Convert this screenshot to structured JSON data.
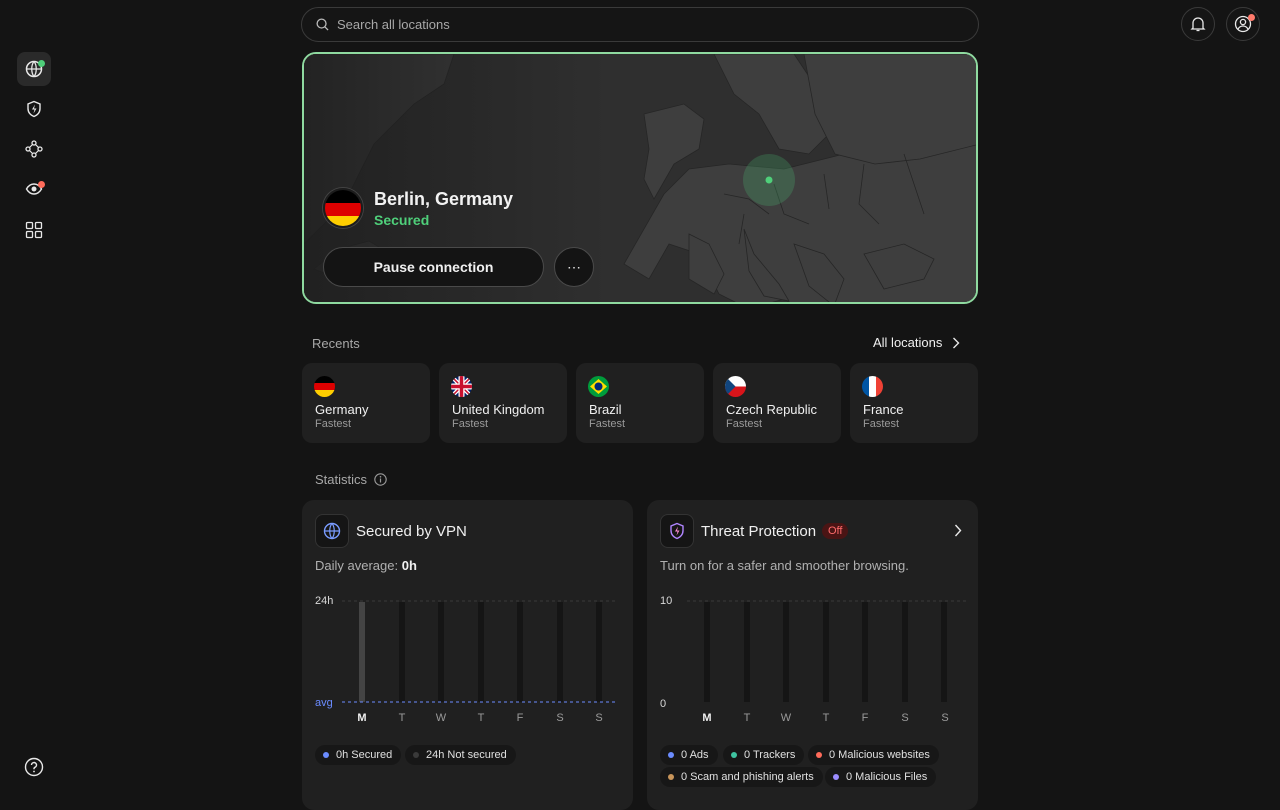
{
  "search": {
    "placeholder": "Search all locations"
  },
  "connection": {
    "location": "Berlin, Germany",
    "status": "Secured",
    "pause_label": "Pause connection",
    "more_label": "⋯"
  },
  "recents": {
    "heading": "Recents",
    "all_label": "All locations",
    "items": [
      {
        "name": "Germany",
        "sub": "Fastest",
        "flag": "de"
      },
      {
        "name": "United Kingdom",
        "sub": "Fastest",
        "flag": "gb"
      },
      {
        "name": "Brazil",
        "sub": "Fastest",
        "flag": "br"
      },
      {
        "name": "Czech Republic",
        "sub": "Fastest",
        "flag": "cz"
      },
      {
        "name": "France",
        "sub": "Fastest",
        "flag": "fr"
      }
    ]
  },
  "statistics": {
    "heading": "Statistics",
    "vpn": {
      "title": "Secured by VPN",
      "daily_label": "Daily average: ",
      "daily_value": "0h",
      "y_top": "24h",
      "y_avg": "avg",
      "legend": [
        {
          "label": "0h Secured",
          "color": "#6b8cff"
        },
        {
          "label": "24h Not secured",
          "color": "#3a3a3a"
        }
      ]
    },
    "threat": {
      "title": "Threat Protection",
      "badge": "Off",
      "subtitle": "Turn on for a safer and smoother browsing.",
      "y_top": "10",
      "y_bottom": "0",
      "legend": [
        {
          "label": "0 Ads",
          "color": "#6b8cff"
        },
        {
          "label": "0 Trackers",
          "color": "#3fc3a0"
        },
        {
          "label": "0 Malicious websites",
          "color": "#ff6b5a"
        },
        {
          "label": "0 Scam and phishing alerts",
          "color": "#c8955a"
        },
        {
          "label": "0 Malicious Files",
          "color": "#9b8cff"
        }
      ]
    },
    "days": [
      "M",
      "T",
      "W",
      "T",
      "F",
      "S",
      "S"
    ]
  },
  "colors": {
    "accent": "#4fcf7a",
    "border_active": "#8fdaa0",
    "avg_line": "#6b8cff"
  },
  "icons": [
    "globe-icon",
    "shield-bolt-icon",
    "mesh-icon",
    "eye-icon",
    "apps-grid-icon",
    "help-icon",
    "search-icon",
    "bell-icon",
    "user-icon",
    "chevron-right-icon"
  ]
}
